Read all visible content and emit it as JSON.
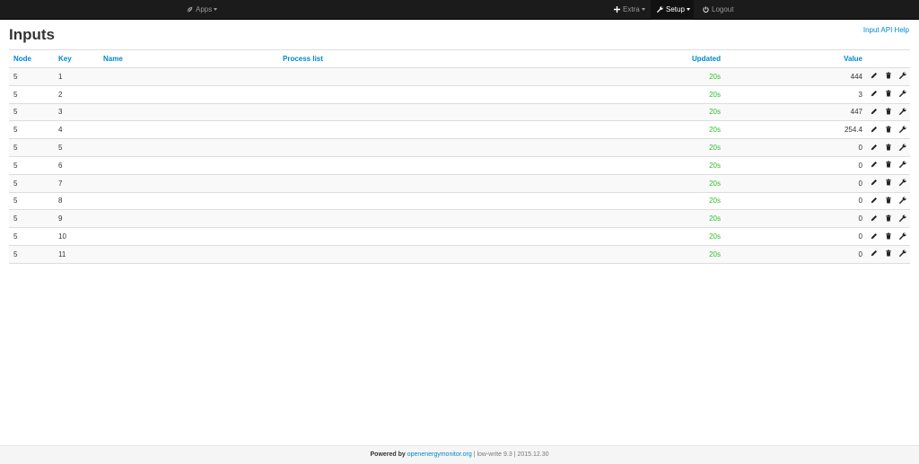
{
  "navbar": {
    "apps_label": "Apps",
    "extra_label": "Extra",
    "setup_label": "Setup",
    "logout_label": "Logout"
  },
  "page": {
    "title": "Inputs",
    "help_link": "Input API Help"
  },
  "table": {
    "headers": {
      "node": "Node",
      "key": "Key",
      "name": "Name",
      "process_list": "Process list",
      "updated": "Updated",
      "value": "Value"
    },
    "rows": [
      {
        "node": "5",
        "key": "1",
        "name": "",
        "process_list": "",
        "updated": "20s",
        "value": "444"
      },
      {
        "node": "5",
        "key": "2",
        "name": "",
        "process_list": "",
        "updated": "20s",
        "value": "3"
      },
      {
        "node": "5",
        "key": "3",
        "name": "",
        "process_list": "",
        "updated": "20s",
        "value": "447"
      },
      {
        "node": "5",
        "key": "4",
        "name": "",
        "process_list": "",
        "updated": "20s",
        "value": "254.4"
      },
      {
        "node": "5",
        "key": "5",
        "name": "",
        "process_list": "",
        "updated": "20s",
        "value": "0"
      },
      {
        "node": "5",
        "key": "6",
        "name": "",
        "process_list": "",
        "updated": "20s",
        "value": "0"
      },
      {
        "node": "5",
        "key": "7",
        "name": "",
        "process_list": "",
        "updated": "20s",
        "value": "0"
      },
      {
        "node": "5",
        "key": "8",
        "name": "",
        "process_list": "",
        "updated": "20s",
        "value": "0"
      },
      {
        "node": "5",
        "key": "9",
        "name": "",
        "process_list": "",
        "updated": "20s",
        "value": "0"
      },
      {
        "node": "5",
        "key": "10",
        "name": "",
        "process_list": "",
        "updated": "20s",
        "value": "0"
      },
      {
        "node": "5",
        "key": "11",
        "name": "",
        "process_list": "",
        "updated": "20s",
        "value": "0"
      }
    ],
    "row_icons": [
      "pencil-icon",
      "trash-icon",
      "wrench-icon"
    ]
  },
  "footer": {
    "powered_by": "Powered by",
    "site_link": "openenergymonitor.org",
    "version_text": "| low-write 9.3 | 2015.12.30"
  },
  "colors": {
    "navbar_bg": "#1b1b1b",
    "link": "#0088cc",
    "updated_green": "#2dbe2d"
  }
}
